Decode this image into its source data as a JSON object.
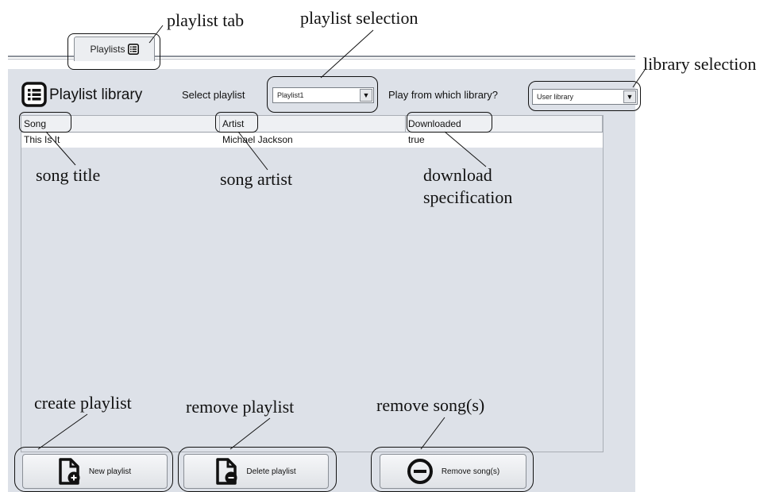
{
  "annotations": {
    "playlist_tab": "playlist tab",
    "playlist_selection": "playlist selection",
    "library_selection": "library selection",
    "song_title": "song title",
    "song_artist": "song artist",
    "download_line1": "download",
    "download_line2": "specification",
    "create_playlist": "create playlist",
    "remove_playlist": "remove playlist",
    "remove_songs": "remove song(s)"
  },
  "tab": {
    "label": "Playlists",
    "icon": "list-icon"
  },
  "header": {
    "title": "Playlist library",
    "select_playlist_label": "Select playlist",
    "playlist_value": "Playlist1",
    "library_label": "Play from which library?",
    "library_value": "User library"
  },
  "table": {
    "columns": [
      "Song",
      "Artist",
      "Downloaded"
    ],
    "rows": [
      [
        "This Is It",
        "Michael Jackson",
        "true"
      ]
    ]
  },
  "buttons": {
    "new_playlist": "New playlist",
    "delete_playlist": "Delete playlist",
    "remove_songs": "Remove song(s)"
  },
  "colors": {
    "panel": "#dde1e8",
    "accent": "#111111"
  }
}
